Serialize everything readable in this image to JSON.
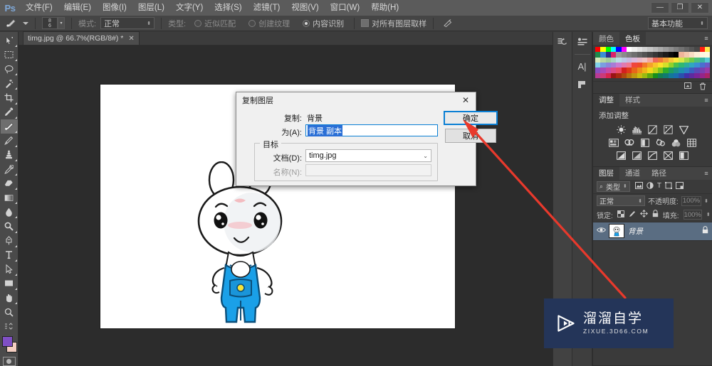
{
  "app": {
    "logo": "Ps",
    "workspace": "基本功能"
  },
  "window_controls": {
    "minimize": "—",
    "restore": "❐",
    "close": "✕"
  },
  "menu": {
    "items": [
      {
        "label": "文件(F)"
      },
      {
        "label": "编辑(E)"
      },
      {
        "label": "图像(I)"
      },
      {
        "label": "图层(L)"
      },
      {
        "label": "文字(Y)"
      },
      {
        "label": "选择(S)"
      },
      {
        "label": "滤镜(T)"
      },
      {
        "label": "视图(V)"
      },
      {
        "label": "窗口(W)"
      },
      {
        "label": "帮助(H)"
      }
    ]
  },
  "options_bar": {
    "brush_size_top": "8",
    "brush_size_bottom": "6",
    "mode_label": "模式:",
    "mode_value": "正常",
    "type_label": "类型:",
    "type_options": [
      {
        "label": "近似匹配",
        "selected": false
      },
      {
        "label": "创建纹理",
        "selected": false
      },
      {
        "label": "内容识别",
        "selected": true
      }
    ],
    "sample_all_layers": "对所有图层取样"
  },
  "toolbar": {
    "tools": [
      {
        "name": "move-tool",
        "selected": false
      },
      {
        "name": "rectangular-marquee-tool",
        "selected": false
      },
      {
        "name": "lasso-tool",
        "selected": false
      },
      {
        "name": "magic-wand-tool",
        "selected": false
      },
      {
        "name": "crop-tool",
        "selected": false
      },
      {
        "name": "eyedropper-tool",
        "selected": false
      },
      {
        "name": "spot-healing-brush-tool",
        "selected": true
      },
      {
        "name": "brush-tool",
        "selected": false
      },
      {
        "name": "clone-stamp-tool",
        "selected": false
      },
      {
        "name": "history-brush-tool",
        "selected": false
      },
      {
        "name": "eraser-tool",
        "selected": false
      },
      {
        "name": "gradient-tool",
        "selected": false
      },
      {
        "name": "blur-tool",
        "selected": false
      },
      {
        "name": "dodge-tool",
        "selected": false
      },
      {
        "name": "pen-tool",
        "selected": false
      },
      {
        "name": "horizontal-type-tool",
        "selected": false
      },
      {
        "name": "path-selection-tool",
        "selected": false
      },
      {
        "name": "rectangle-tool",
        "selected": false
      },
      {
        "name": "hand-tool",
        "selected": false
      },
      {
        "name": "zoom-tool",
        "selected": false
      }
    ],
    "foreground_color": "#7f4fc4",
    "background_color": "#f5cfc2"
  },
  "document": {
    "tab_label": "timg.jpg @ 66.7%(RGB/8#) *",
    "close_glyph": "✕",
    "zoom": "66.7%",
    "color_mode": "RGB/8#",
    "filename": "timg.jpg"
  },
  "dialog": {
    "title": "复制图层",
    "close_glyph": "✕",
    "duplicate_label": "复制:",
    "duplicate_value": "背景",
    "as_label": "为(A):",
    "as_value": "背景 副本",
    "group_legend": "目标",
    "document_label": "文档(D):",
    "document_value": "timg.jpg",
    "name_label": "名称(N):",
    "name_value": "",
    "ok_button": "确定",
    "cancel_button": "取消",
    "combo_arrow": "⌄"
  },
  "panels": {
    "color_swatches": {
      "tabs": [
        {
          "label": "颜色",
          "active": false
        },
        {
          "label": "色板",
          "active": true
        }
      ],
      "menu_glyph": "≡",
      "colors": [
        "#ff0000",
        "#ffff00",
        "#00ff00",
        "#00ffff",
        "#0000ff",
        "#ff00ff",
        "#ffffff",
        "#f0f0f0",
        "#e2e2e2",
        "#d4d4d4",
        "#c6c6c6",
        "#b8b8b8",
        "#aaaaaa",
        "#9c9c9c",
        "#8e8e8e",
        "#808080",
        "#727272",
        "#646464",
        "#565656",
        "#484848",
        "#ff2010",
        "#ffe84a",
        "#1f8a4c",
        "#3a8fd4",
        "#2b2f8a",
        "#d9236a",
        "#9a9a9a",
        "#8b8b8b",
        "#7d7d7d",
        "#6f6f6f",
        "#616161",
        "#535353",
        "#454545",
        "#373737",
        "#292929",
        "#1b1b1b",
        "#0d0d0d",
        "#000000",
        "#f0b49a",
        "#f5c9ae",
        "#f8dcc4",
        "#fdefd8",
        "#fff4e0",
        "#fffadf",
        "#d7e8b8",
        "#b7d9a0",
        "#9fcf9b",
        "#a6d6c2",
        "#b9dde6",
        "#bcc8e6",
        "#c8b9e0",
        "#dcb9db",
        "#e8b9c9",
        "#f0c3c3",
        "#f4a8a0",
        "#ee6a5a",
        "#f07a3c",
        "#f4a23a",
        "#f7c83a",
        "#fbe63a",
        "#d6e84a",
        "#9ed84a",
        "#6ecb4a",
        "#4cc07a",
        "#3cb5a0",
        "#58c8d4",
        "#7fd0e8",
        "#7a9fe0",
        "#8a86dc",
        "#a77cd6",
        "#c97cd0",
        "#e07ab0",
        "#ef7a92",
        "#f0463c",
        "#ee4a2a",
        "#f2772a",
        "#f5a12a",
        "#f8c52a",
        "#fbe22a",
        "#d4e02a",
        "#92d22a",
        "#4cc14a",
        "#30b872",
        "#2cae9a",
        "#2fa7c0",
        "#3a8fd4",
        "#4a6fd0",
        "#6a5ac8",
        "#8a4fc0",
        "#aa4ab8",
        "#c84aa4",
        "#dd4a86",
        "#ea4a64",
        "#d32020",
        "#e03a1a",
        "#e8661a",
        "#ec8f1a",
        "#f0b41a",
        "#f4d81a",
        "#c2d41a",
        "#7ec41a",
        "#2fae2a",
        "#1f9e60",
        "#1c9488",
        "#1e8fae",
        "#2b7fc4",
        "#3b5fc0",
        "#5a4ab8",
        "#7a3fb0",
        "#9a3aa8",
        "#b83a94",
        "#cc3a78",
        "#d8244c",
        "#9a1414",
        "#a82a10",
        "#b04a10",
        "#b87410",
        "#c09810",
        "#c8bc10",
        "#9aba10",
        "#5ea810",
        "#17901a",
        "#118050",
        "#107a70",
        "#12789a",
        "#1a6cae",
        "#2a50ae",
        "#4230a8",
        "#5e2aa0",
        "#7a2498",
        "#96248a",
        "#aa2468"
      ]
    },
    "adjustments": {
      "tabs": [
        {
          "label": "调整",
          "active": true
        },
        {
          "label": "样式",
          "active": false
        }
      ],
      "menu_glyph": "≡",
      "title": "添加调整",
      "rows": [
        [
          "brightness-contrast-icon",
          "levels-icon",
          "curves-icon",
          "exposure-icon",
          "vibrance-icon"
        ],
        [
          "hue-saturation-icon",
          "color-balance-icon",
          "black-white-icon",
          "photo-filter-icon",
          "channel-mixer-icon",
          "color-lookup-icon"
        ],
        [
          "invert-icon",
          "posterize-icon",
          "threshold-icon",
          "gradient-map-icon",
          "selective-color-icon"
        ]
      ],
      "top_icons": [
        "clip-to-layer-icon",
        "delete-adjustment-icon"
      ]
    },
    "layers": {
      "tabs": [
        {
          "label": "图层",
          "active": true
        },
        {
          "label": "通道",
          "active": false
        },
        {
          "label": "路径",
          "active": false
        }
      ],
      "menu_glyph": "≡",
      "filter_label": "类型",
      "filter_icons": [
        "pixel-filter-icon",
        "adjustment-filter-icon",
        "type-filter-icon",
        "shape-filter-icon",
        "smartobject-filter-icon"
      ],
      "blend_mode": "正常",
      "opacity_label": "不透明度:",
      "opacity_value": "100%",
      "lock_label": "锁定:",
      "lock_icons": [
        "lock-transparent-icon",
        "lock-image-icon",
        "lock-position-icon",
        "lock-all-icon"
      ],
      "fill_label": "填充:",
      "fill_value": "100%",
      "rows": [
        {
          "name": "背景",
          "visible": true,
          "locked": true
        }
      ]
    }
  },
  "dock_icons": {
    "column_a": [
      "history-panel-icon"
    ],
    "column_b": [
      "properties-panel-icon",
      "character-panel-icon",
      "paragraph-panel-icon"
    ]
  },
  "watermark": {
    "title": "溜溜自学",
    "subtitle": "ZIXUE.3D66.COM",
    "background": "#243559"
  },
  "annotation": {
    "arrow_color": "#e8392c",
    "points_to": "确定"
  }
}
